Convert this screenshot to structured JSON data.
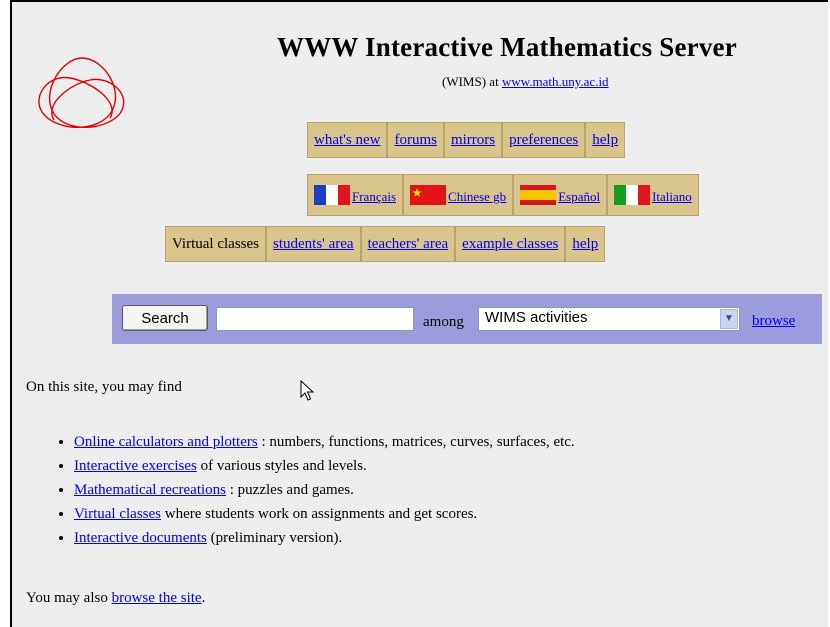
{
  "header": {
    "title": "WWW Interactive Mathematics Server",
    "subtitle_prefix": "(WIMS) at ",
    "site_link": "www.math.uny.ac.id"
  },
  "nav_top": [
    "what's new",
    "forums",
    "mirrors",
    "preferences",
    "help"
  ],
  "languages": [
    "Français",
    "Chinese gb",
    "Español",
    "Italiano"
  ],
  "nav_classes": {
    "label": "Virtual classes",
    "links": [
      "students' area",
      "teachers' area",
      "example classes",
      "help"
    ]
  },
  "search": {
    "button_label": "Search",
    "input_value": "",
    "among_label": "among",
    "selected_option": "WIMS activities",
    "browse_label": "browse"
  },
  "content": {
    "intro": "On this site, you may find",
    "items": [
      {
        "link": "Online calculators and plotters",
        "rest": " : numbers, functions, matrices, curves, surfaces, etc."
      },
      {
        "link": "Interactive exercises",
        "rest": " of various styles and levels."
      },
      {
        "link": "Mathematical recreations",
        "rest": " : puzzles and games."
      },
      {
        "link": "Virtual classes",
        "rest": " where students work on assignments and get scores."
      },
      {
        "link": "Interactive documents",
        "rest": " (preliminary version)."
      }
    ],
    "also_prefix": "You may also ",
    "also_link": "browse the site",
    "also_suffix": "."
  },
  "colors": {
    "page_bg": "#ededed",
    "nav_cell": "#d9c48c",
    "search_bar": "#9c9cdc",
    "link": "#0000ee",
    "logo": "#e00000"
  }
}
